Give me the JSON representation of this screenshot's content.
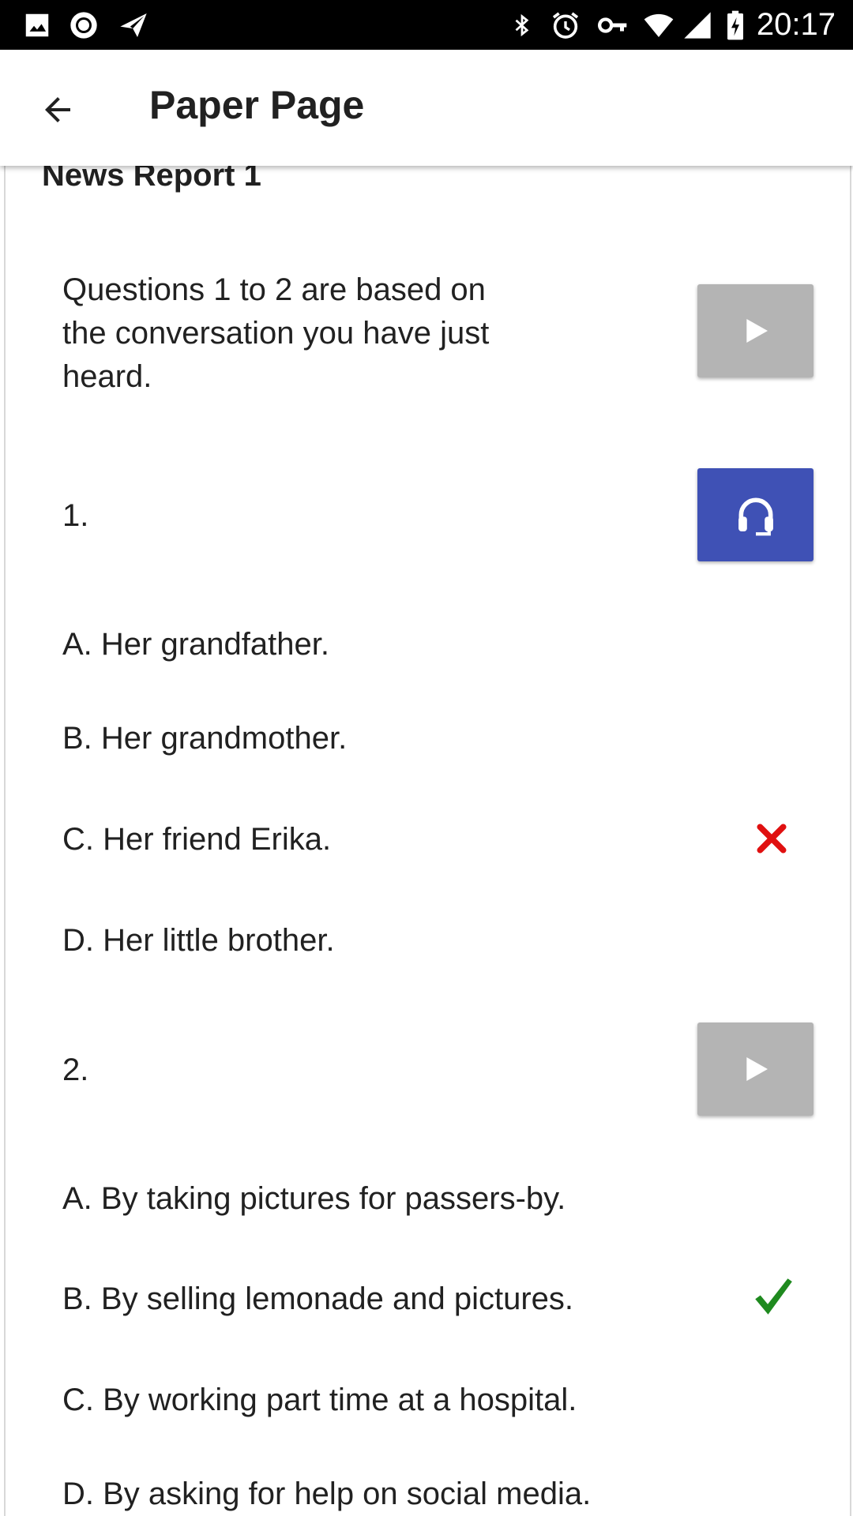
{
  "status_bar": {
    "time": "20:17",
    "left_icons": [
      "image-icon",
      "record-icon",
      "send-icon"
    ],
    "right_icons": [
      "bluetooth-icon",
      "alarm-icon",
      "vpn-key-icon",
      "wifi-icon",
      "signal-icon",
      "battery-charging-icon"
    ]
  },
  "app_bar": {
    "title": "Paper Page",
    "back_icon": "arrow-back-icon"
  },
  "section": {
    "title": "News Report 1",
    "intro": "Questions 1 to 2 are based on the conversation you have just heard."
  },
  "questions": [
    {
      "number": "1.",
      "options": [
        {
          "text": "A. Her grandfather."
        },
        {
          "text": "B. Her grandmother."
        },
        {
          "text": "C. Her friend Erika.",
          "mark": "wrong"
        },
        {
          "text": "D. Her little brother."
        }
      ]
    },
    {
      "number": "2.",
      "options": [
        {
          "text": "A. By taking pictures for passers-by."
        },
        {
          "text": "B. By selling lemonade and pictures.",
          "mark": "correct"
        },
        {
          "text": "C. By working part time at a hospital."
        },
        {
          "text": "D. By asking for help on social media."
        }
      ]
    }
  ],
  "colors": {
    "status_bar": "#000000",
    "accent": "#3f51b5",
    "disabled_button": "#b4b4b4",
    "wrong": "#e01010",
    "correct": "#1f8a1f"
  }
}
